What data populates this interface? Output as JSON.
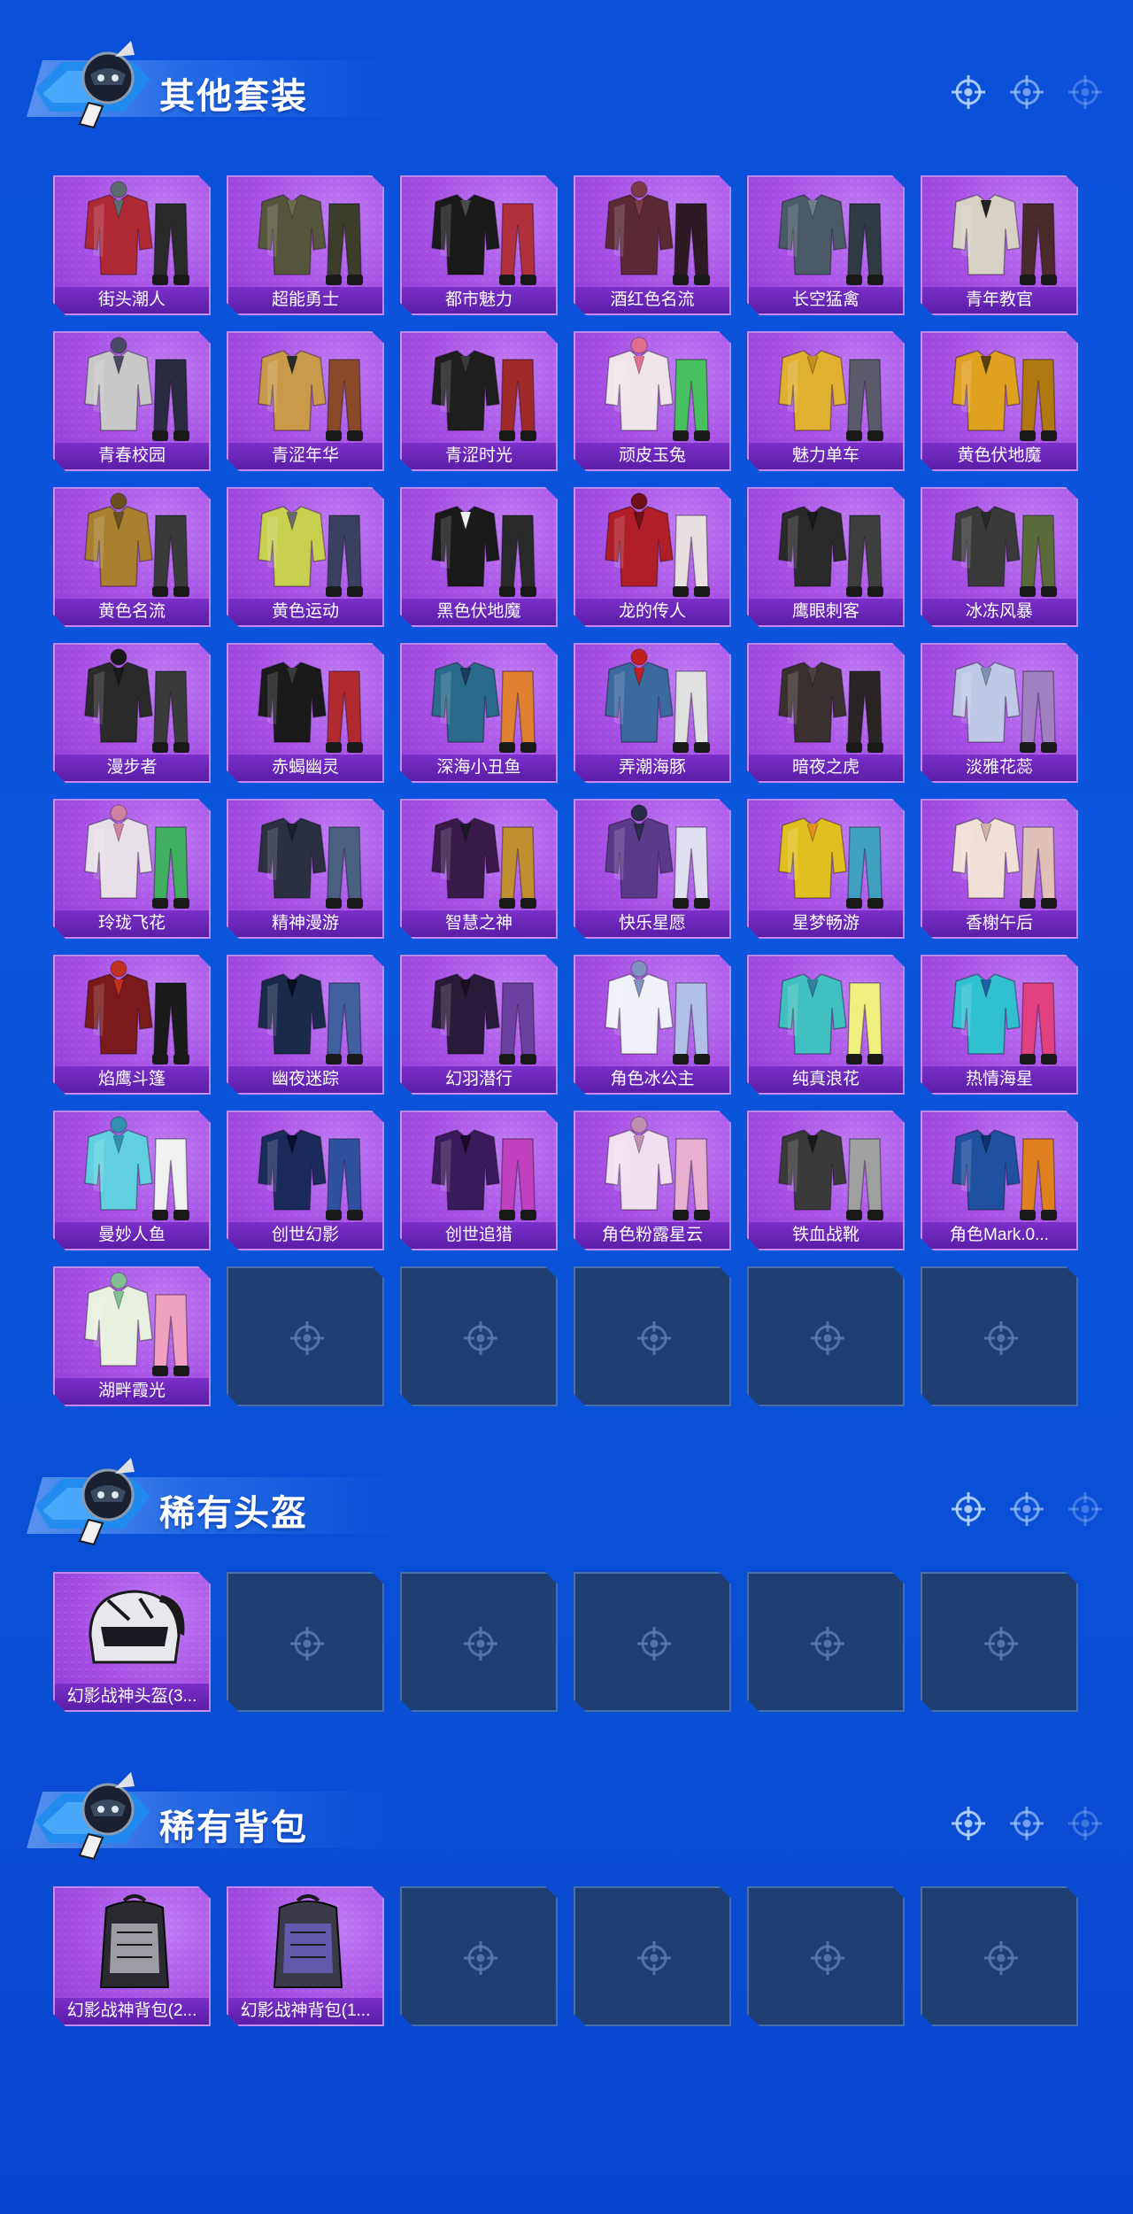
{
  "sections": [
    {
      "title": "其他套装",
      "items": [
        {
          "label": "街头潮人"
        },
        {
          "label": "超能勇士"
        },
        {
          "label": "都市魅力"
        },
        {
          "label": "酒红色名流"
        },
        {
          "label": "长空猛禽"
        },
        {
          "label": "青年教官"
        },
        {
          "label": "青春校园"
        },
        {
          "label": "青涩年华"
        },
        {
          "label": "青涩时光"
        },
        {
          "label": "顽皮玉兔"
        },
        {
          "label": "魅力单车"
        },
        {
          "label": "黄色伏地魔"
        },
        {
          "label": "黄色名流"
        },
        {
          "label": "黄色运动"
        },
        {
          "label": "黑色伏地魔"
        },
        {
          "label": "龙的传人"
        },
        {
          "label": "鹰眼刺客"
        },
        {
          "label": "冰冻风暴"
        },
        {
          "label": "漫步者"
        },
        {
          "label": "赤蝎幽灵"
        },
        {
          "label": "深海小丑鱼"
        },
        {
          "label": "弄潮海豚"
        },
        {
          "label": "暗夜之虎"
        },
        {
          "label": "淡雅花蕊"
        },
        {
          "label": "玲珑飞花"
        },
        {
          "label": "精神漫游"
        },
        {
          "label": "智慧之神"
        },
        {
          "label": "快乐星愿"
        },
        {
          "label": "星梦畅游"
        },
        {
          "label": "香榭午后"
        },
        {
          "label": "焰鹰斗篷"
        },
        {
          "label": "幽夜迷踪"
        },
        {
          "label": "幻羽潜行"
        },
        {
          "label": "角色冰公主"
        },
        {
          "label": "纯真浪花"
        },
        {
          "label": "热情海星"
        },
        {
          "label": "曼妙人鱼"
        },
        {
          "label": "创世幻影"
        },
        {
          "label": "创世追猎"
        },
        {
          "label": "角色粉露星云"
        },
        {
          "label": "铁血战靴"
        },
        {
          "label": "角色Mark.0..."
        },
        {
          "label": "湖畔霞光"
        }
      ],
      "empty_slots": 5
    },
    {
      "title": "稀有头盔",
      "items": [
        {
          "label": "幻影战神头盔(3..."
        }
      ],
      "empty_slots": 5
    },
    {
      "title": "稀有背包",
      "items": [
        {
          "label": "幻影战神背包(2..."
        },
        {
          "label": "幻影战神背包(1..."
        }
      ],
      "empty_slots": 4
    }
  ],
  "colors": {
    "background": "#0a4fd8",
    "card_purple": "#a650e4",
    "label_purple": "#5a1da7",
    "empty_slot": "#1f3f72"
  }
}
